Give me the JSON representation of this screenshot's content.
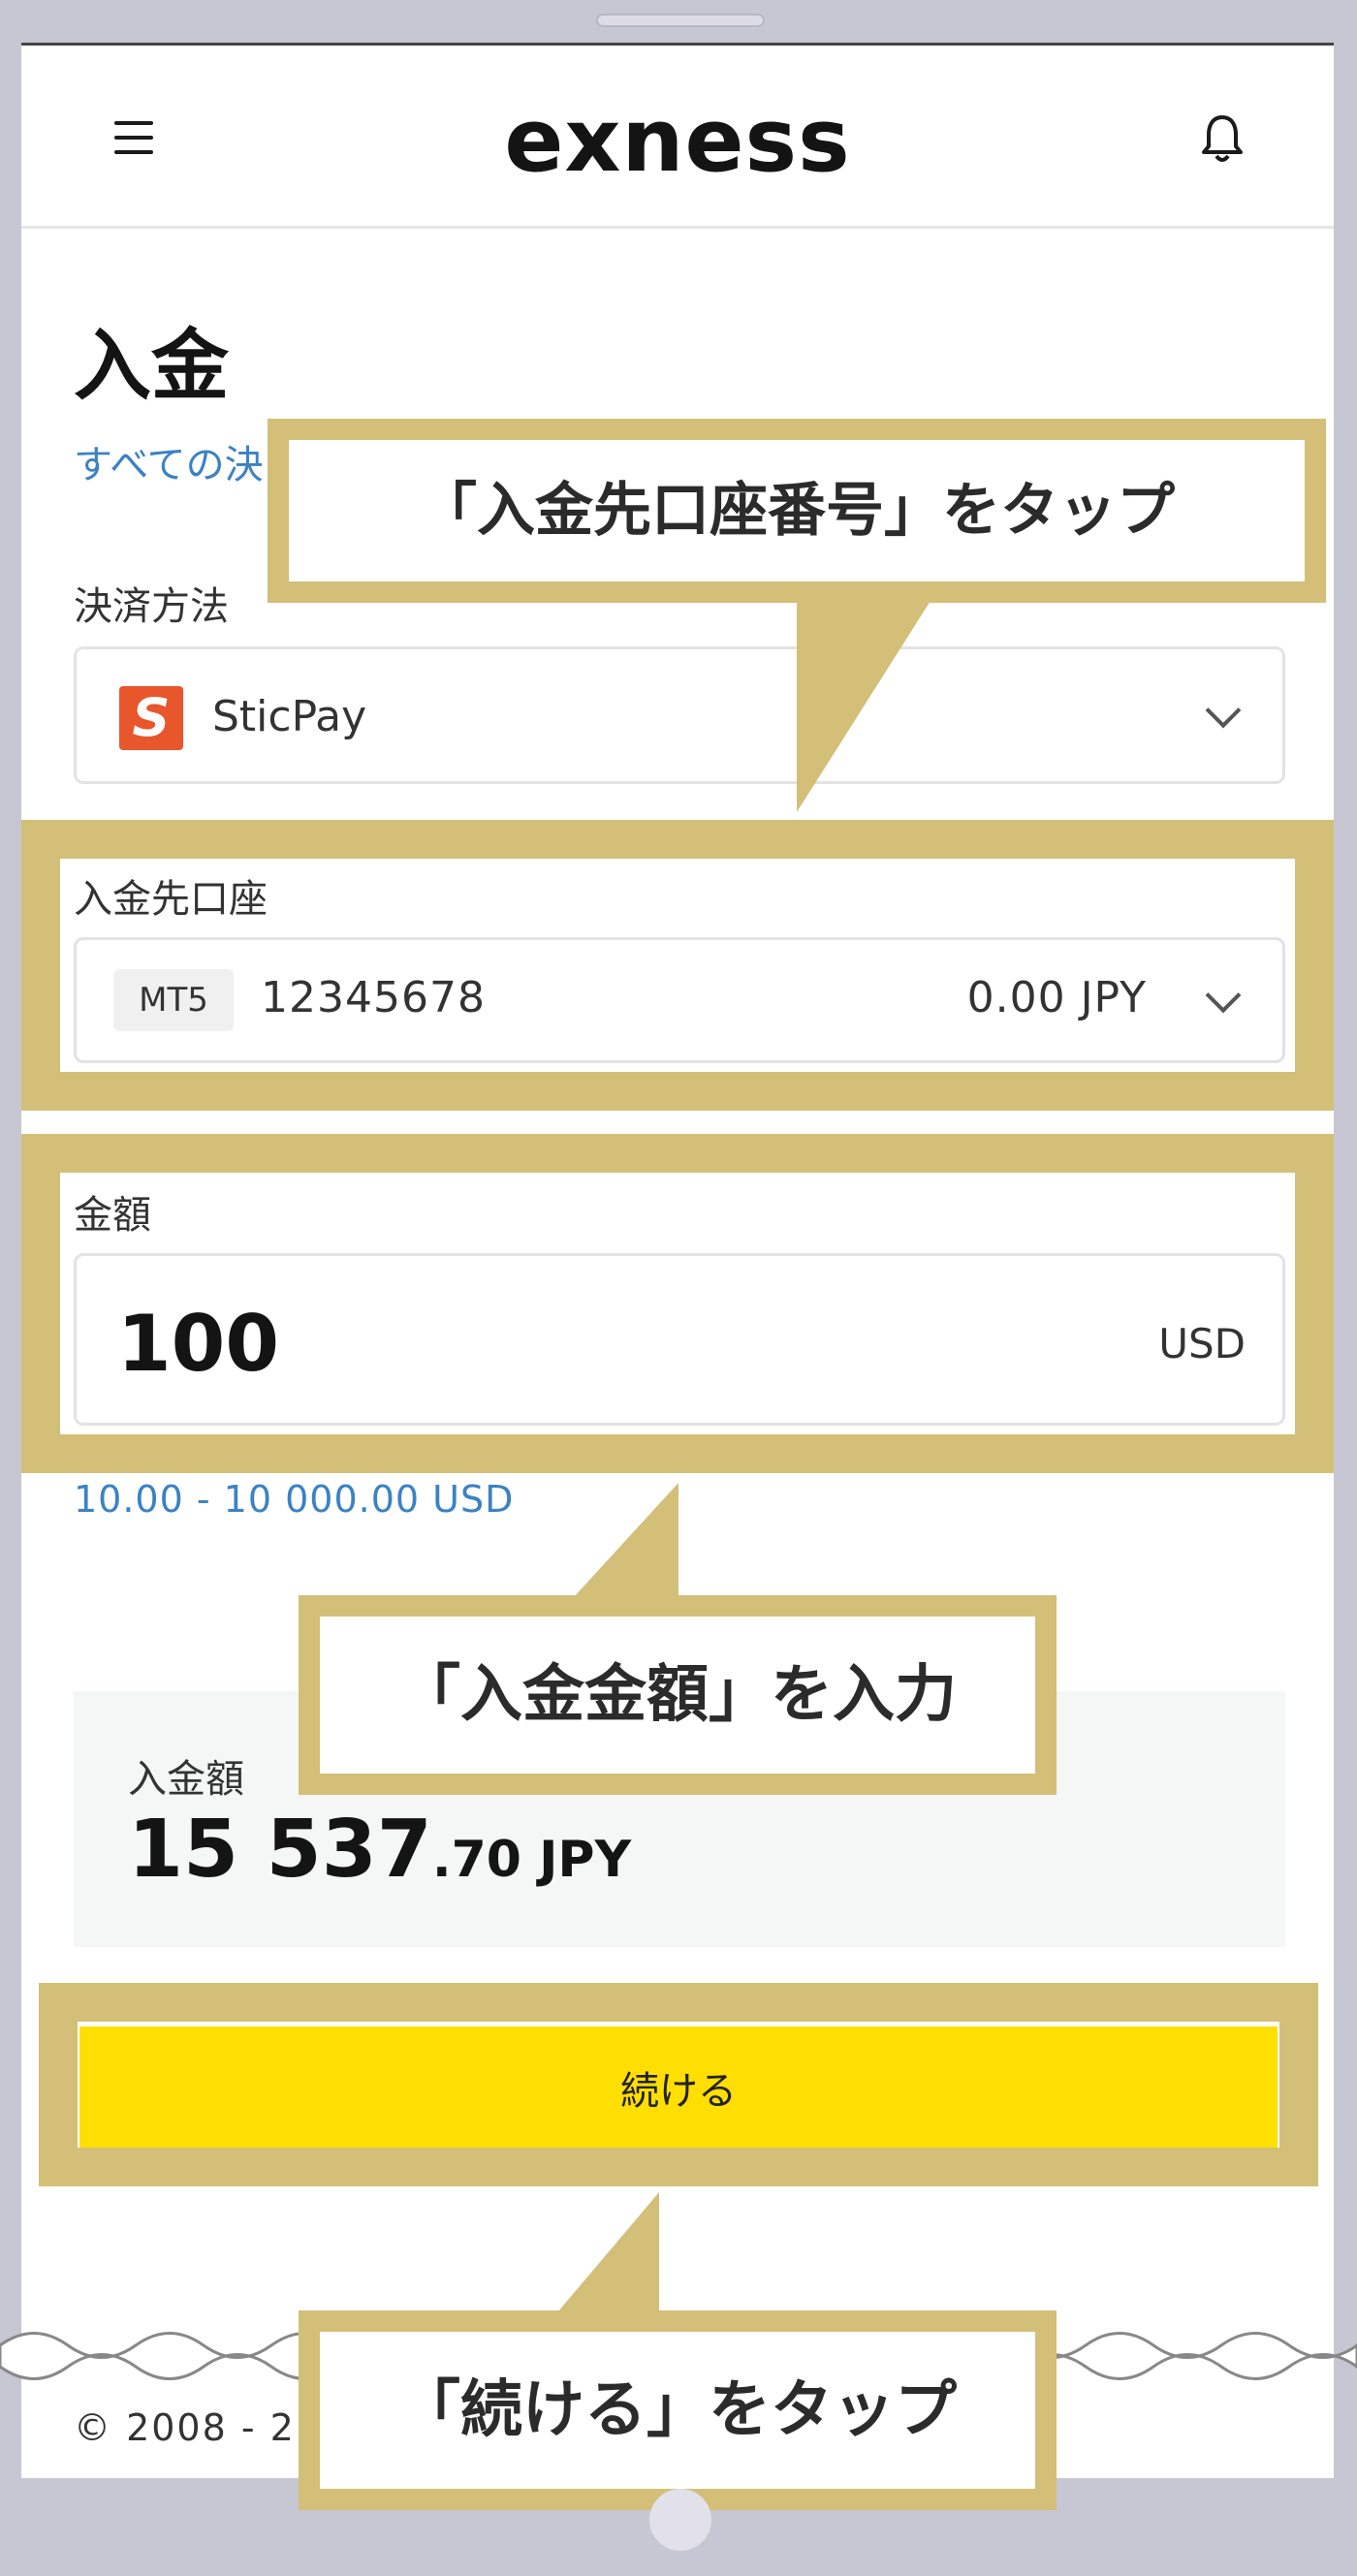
{
  "header": {
    "logo": "exness"
  },
  "page": {
    "title": "入金",
    "all_methods_link": "すべての決"
  },
  "payment_method": {
    "label": "決済方法",
    "icon_letter": "S",
    "selected": "SticPay"
  },
  "deposit_account": {
    "label": "入金先口座",
    "platform": "MT5",
    "number": "12345678",
    "balance": "0.00 JPY"
  },
  "amount": {
    "label": "金額",
    "value": "100",
    "currency": "USD",
    "range": "10.00 - 10 000.00 USD"
  },
  "summary": {
    "label": "入金額",
    "value_main": "15 537",
    "value_decimal": ".70",
    "currency": "JPY"
  },
  "continue_button": {
    "label": "続ける"
  },
  "footer": {
    "copyright": "© 2008 - 2"
  },
  "annotations": {
    "tap_account": "「入金先口座番号」をタップ",
    "enter_amount": "「入金金額」を入力",
    "tap_continue": "「続ける」をタップ"
  },
  "colors": {
    "accent_yellow": "#ffde02",
    "highlight_gold": "#d3bf78",
    "link_blue": "#3b82c4",
    "sticpay_orange": "#e8562b"
  }
}
